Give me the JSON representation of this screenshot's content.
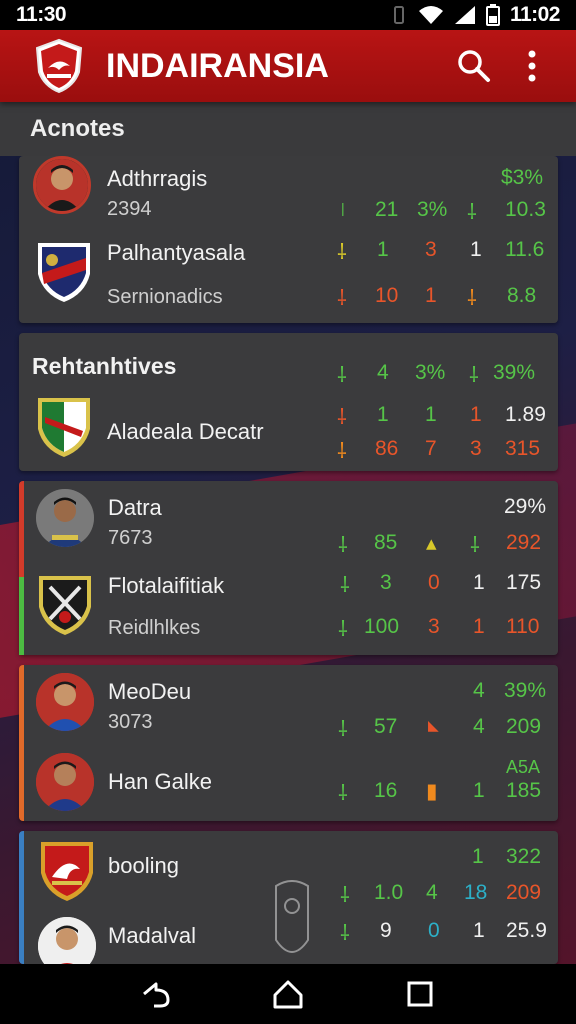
{
  "status_bar": {
    "time_left": "11:30",
    "time_right": "11:02"
  },
  "app_bar": {
    "title": "INDAIRANSIA"
  },
  "section": {
    "title": "Acnotes"
  },
  "card1": {
    "row1": {
      "name": "Adthrragis",
      "sub": "2394",
      "pct_top": "$3%",
      "c1": "21",
      "c2": "3%",
      "c3": "10.3"
    },
    "row2": {
      "name": "Palhantyasala",
      "c1": "1",
      "c2": "3",
      "c3": "1",
      "c4": "11.6"
    },
    "row3": {
      "sub": "Sernionadics",
      "c1": "10",
      "c2": "1",
      "c3": "8.8"
    }
  },
  "card2": {
    "row1": {
      "name": "Rehtanhtives",
      "c1": "4",
      "c2": "3%",
      "c3": "39%"
    },
    "row2": {
      "name": "Aladeala Decatr",
      "c1": "1",
      "c2": "1",
      "c3": "1",
      "c4": "1.89"
    },
    "row3": {
      "c1": "86",
      "c2": "7",
      "c3": "3",
      "c4": "315"
    }
  },
  "card3": {
    "row1": {
      "name": "Datra",
      "sub": "7673",
      "pct_top": "29%",
      "c1": "85",
      "c2": "292"
    },
    "row2": {
      "name": "Flotalaifitiak",
      "sub": "Reidlhlkes",
      "c1": "3",
      "c2": "0",
      "c3": "1",
      "c4": "175",
      "d1": "100",
      "d2": "3",
      "d3": "1",
      "d4": "110"
    }
  },
  "card4": {
    "row1": {
      "name": "MeoDeu",
      "sub": "3073",
      "c1": "4",
      "c2": "39%",
      "d1": "57",
      "d2": "4",
      "d3": "209"
    },
    "row2": {
      "name": "Han Galke",
      "c0": "A5A",
      "c1": "16",
      "c2": "1",
      "c3": "185"
    }
  },
  "card5": {
    "row1": {
      "name": "booling",
      "c1": "1",
      "c2": "322",
      "d1": "1.0",
      "d2": "4",
      "d3": "18",
      "d4": "209"
    },
    "row2": {
      "name": "Madalval",
      "c1": "9",
      "c2": "0",
      "c3": "1",
      "c4": "25.9"
    }
  },
  "colors": {
    "accent": "#b81414",
    "positive": "#56c548",
    "negative": "#e8552a"
  },
  "icons": [
    "search-icon",
    "more-vert-icon",
    "back-icon",
    "home-icon",
    "recents-icon",
    "wifi-icon",
    "signal-icon",
    "battery-icon"
  ]
}
